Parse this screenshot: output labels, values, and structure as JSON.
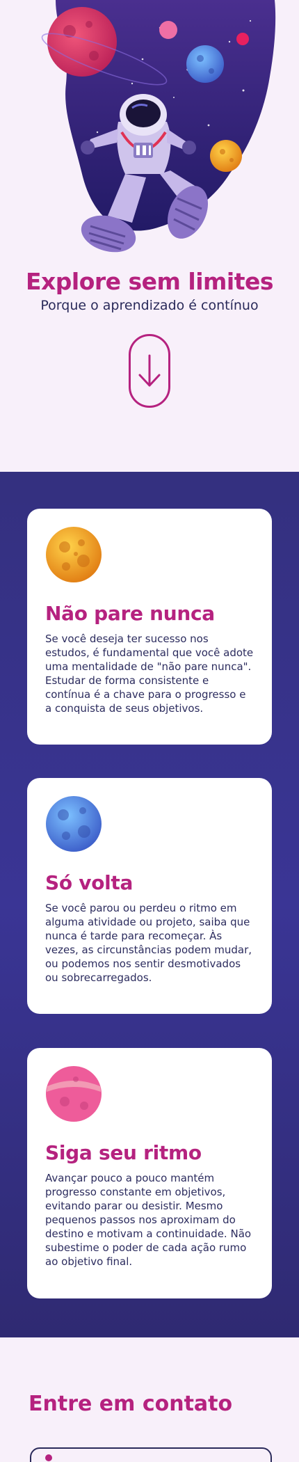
{
  "hero": {
    "title": "Explore sem limites",
    "subtitle": "Porque o aprendizado é contínuo",
    "scroll_icon": "arrow-down-icon"
  },
  "cards": [
    {
      "planet": "orange-planet-icon",
      "title": "Não pare nunca",
      "text": "Se você deseja ter sucesso nos estudos, é fundamental que você adote uma mentalidade de \"não pare nunca\". Estudar de forma consistente e contínua é a chave para o progresso e a conquista de seus objetivos."
    },
    {
      "planet": "blue-planet-icon",
      "title": "Só volta",
      "text": "Se você parou ou perdeu o ritmo em alguma atividade ou projeto, saiba que nunca é tarde para recomeçar. Às vezes, as circunstâncias podem mudar, ou podemos nos sentir desmotivados ou sobrecarregados."
    },
    {
      "planet": "pink-planet-icon",
      "title": "Siga seu ritmo",
      "text": "Avançar pouco a pouco mantém progresso constante em objetivos, evitando parar ou desistir. Mesmo pequenos passos nos aproximam do destino e motivam a continuidade. Não subestime o poder de cada ação rumo ao objetivo final."
    }
  ],
  "contact": {
    "title": "Entre em contato",
    "field_icon": "user-icon"
  },
  "colors": {
    "accent": "#b5227f",
    "text": "#2a2a5a",
    "band": "#34307f",
    "background": "#f8f0fa"
  }
}
